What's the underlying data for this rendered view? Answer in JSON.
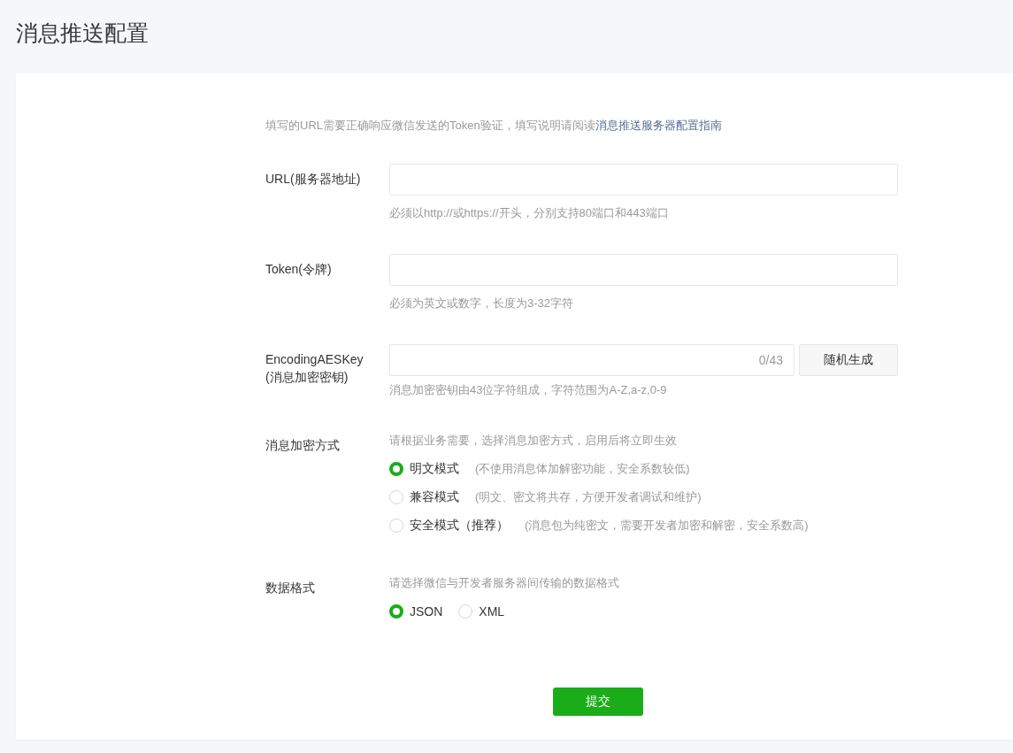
{
  "page_title": "消息推送配置",
  "intro": {
    "text": "填写的URL需要正确响应微信发送的Token验证，填写说明请阅读",
    "link": "消息推送服务器配置指南"
  },
  "fields": [
    {
      "kind": "text",
      "label": "URL(服务器地址)",
      "hint": "必须以http://或https://开头，分别支持80端口和443端口"
    },
    {
      "kind": "text",
      "label": "Token(令牌)",
      "hint": "必须为英文或数字，长度为3-32字符"
    },
    {
      "kind": "key",
      "label": "EncodingAESKey",
      "label_line2": "(消息加密密钥)",
      "counter": "0/43",
      "button": "随机生成",
      "hint": "消息加密密钥由43位字符组成，字符范围为A-Z,a-z,0-9"
    }
  ],
  "encryption": {
    "label": "消息加密方式",
    "description": "请根据业务需要，选择消息加密方式，启用后将立即生效",
    "options": [
      {
        "label": "明文模式",
        "note": "(不使用消息体加解密功能，安全系数较低)",
        "selected": true
      },
      {
        "label": "兼容模式",
        "note": "(明文、密文将共存，方便开发者调试和维护)",
        "selected": false
      },
      {
        "label": "安全模式（推荐）",
        "note": "(消息包为纯密文，需要开发者加密和解密，安全系数高)",
        "selected": false
      }
    ]
  },
  "data_format": {
    "label": "数据格式",
    "description": "请选择微信与开发者服务器间传输的数据格式",
    "options": [
      {
        "label": "JSON",
        "selected": true
      },
      {
        "label": "XML",
        "selected": false
      }
    ]
  },
  "submit": "提交"
}
